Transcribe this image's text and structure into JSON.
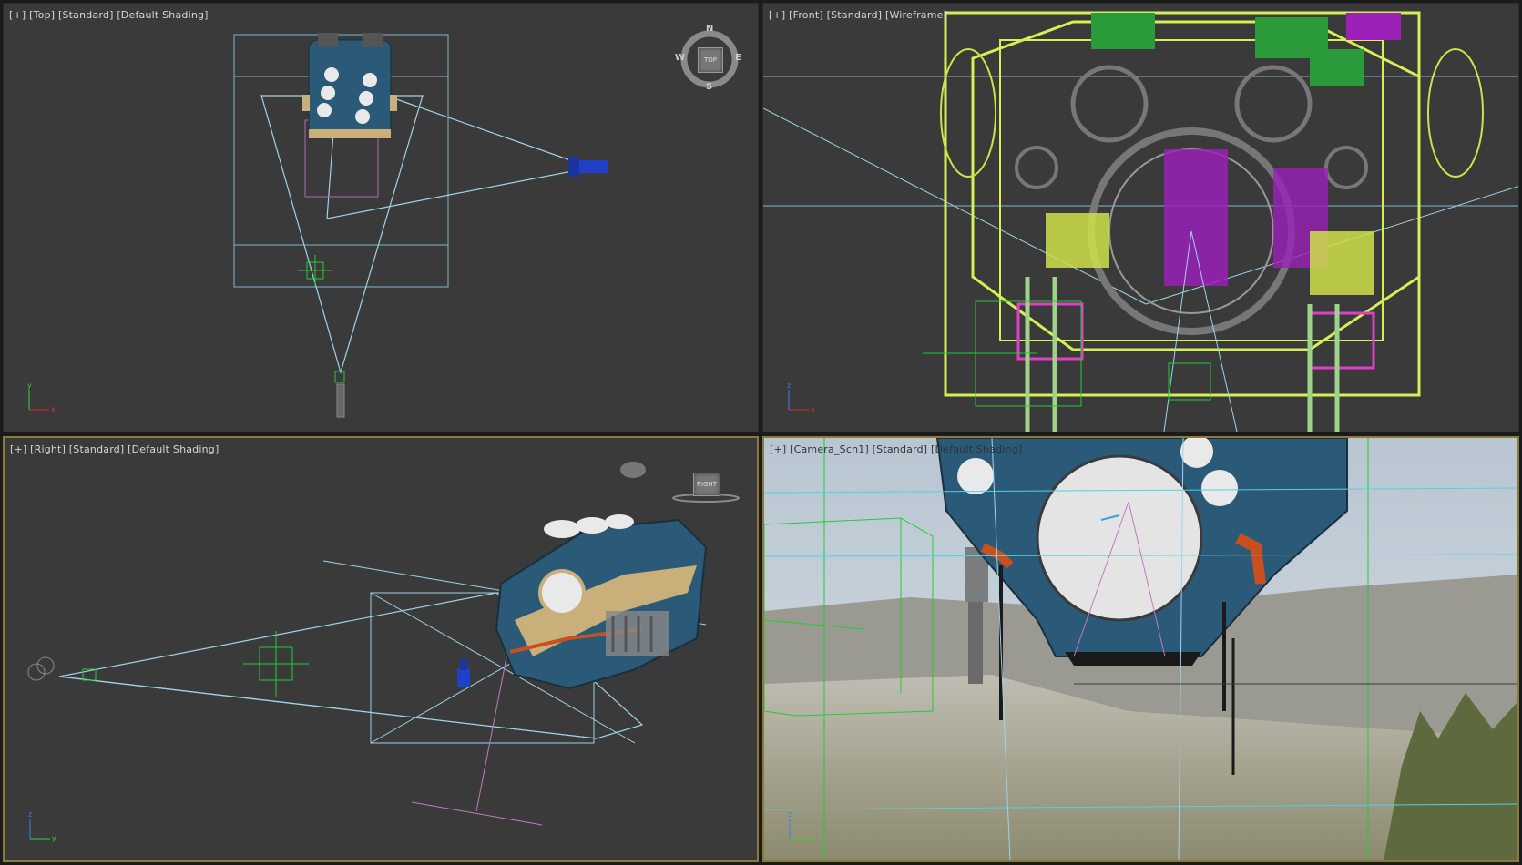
{
  "viewports": {
    "top": {
      "label_parts": [
        "[+]",
        "[Top]",
        "[Standard]",
        "[Default Shading]"
      ],
      "navcube": {
        "face": "TOP",
        "north": "N",
        "south": "S",
        "east": "E",
        "west": "W"
      },
      "axis": {
        "v": "y",
        "h": "x"
      }
    },
    "front": {
      "label_parts": [
        "[+]",
        "[Front]",
        "[Standard]",
        "[Wireframe]"
      ],
      "axis": {
        "v": "z",
        "h": "x"
      }
    },
    "right": {
      "label_parts": [
        "[+]",
        "[Right]",
        "[Standard]",
        "[Default Shading]"
      ],
      "navcube": {
        "face": "RIGHT"
      },
      "axis": {
        "v": "z",
        "h": "y"
      }
    },
    "camera": {
      "label_parts": [
        "[+]",
        "[Camera_Scn1]",
        "[Standard]",
        "[Default Shading]"
      ],
      "axis": {
        "v": "z",
        "h": "y"
      }
    }
  },
  "colors": {
    "viewport_bg": "#3a3a3a",
    "camera_frustum": "#9fd3e8",
    "helper_green": "#22cc33",
    "wire_yellow": "#d7ee55",
    "wire_magenta": "#b030c0",
    "wire_pink": "#e040c8",
    "active_border": "#8c7a3a",
    "ship_blue": "#2b5a78",
    "ship_tan": "#c9b07a",
    "ship_orange": "#c8501e"
  }
}
